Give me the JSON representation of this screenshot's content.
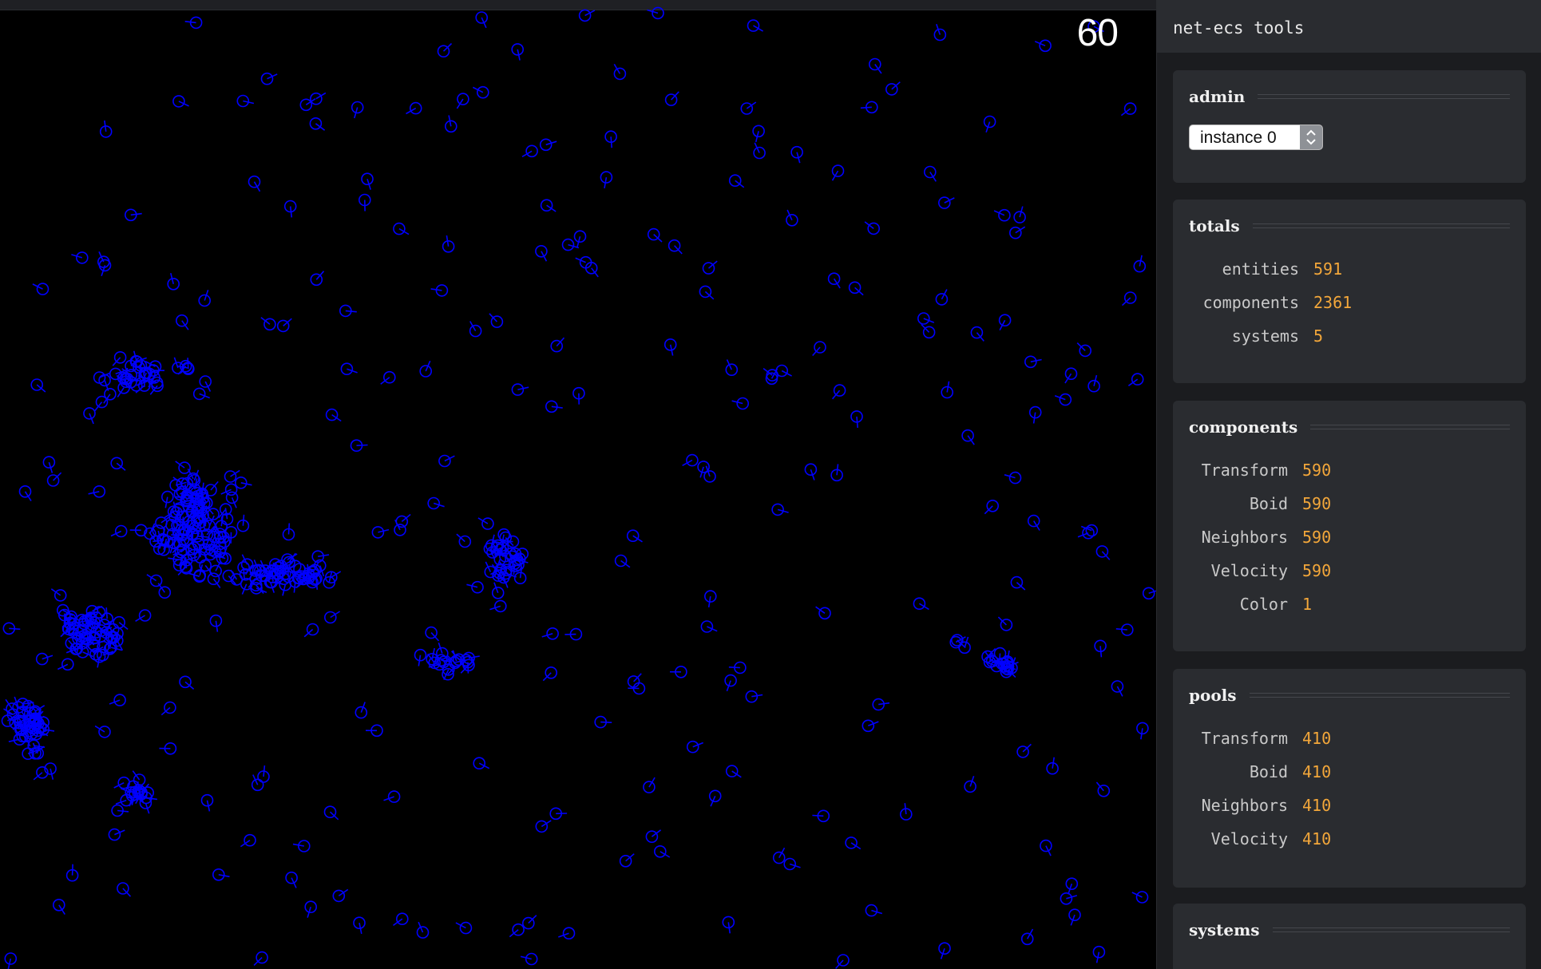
{
  "fps": "60",
  "boid_color": "#0000ff",
  "panel": {
    "title": "net-ecs tools",
    "admin": {
      "title": "admin",
      "instance_value": "instance 0",
      "stepper_icon": "up-down-chevron-icon"
    },
    "totals": {
      "title": "totals",
      "rows": [
        {
          "label": "entities",
          "value": "591"
        },
        {
          "label": "components",
          "value": "2361"
        },
        {
          "label": "systems",
          "value": "5"
        }
      ]
    },
    "components": {
      "title": "components",
      "rows": [
        {
          "label": "Transform",
          "value": "590"
        },
        {
          "label": "Boid",
          "value": "590"
        },
        {
          "label": "Neighbors",
          "value": "590"
        },
        {
          "label": "Velocity",
          "value": "590"
        },
        {
          "label": "Color",
          "value": "1"
        }
      ]
    },
    "pools": {
      "title": "pools",
      "rows": [
        {
          "label": "Transform",
          "value": "410"
        },
        {
          "label": "Boid",
          "value": "410"
        },
        {
          "label": "Neighbors",
          "value": "410"
        },
        {
          "label": "Velocity",
          "value": "410"
        }
      ]
    },
    "systems": {
      "title": "systems"
    }
  },
  "colors": {
    "value_accent": "#f3a73a",
    "panel_bg": "#1b1c1f",
    "card_bg": "#2a2c30"
  }
}
